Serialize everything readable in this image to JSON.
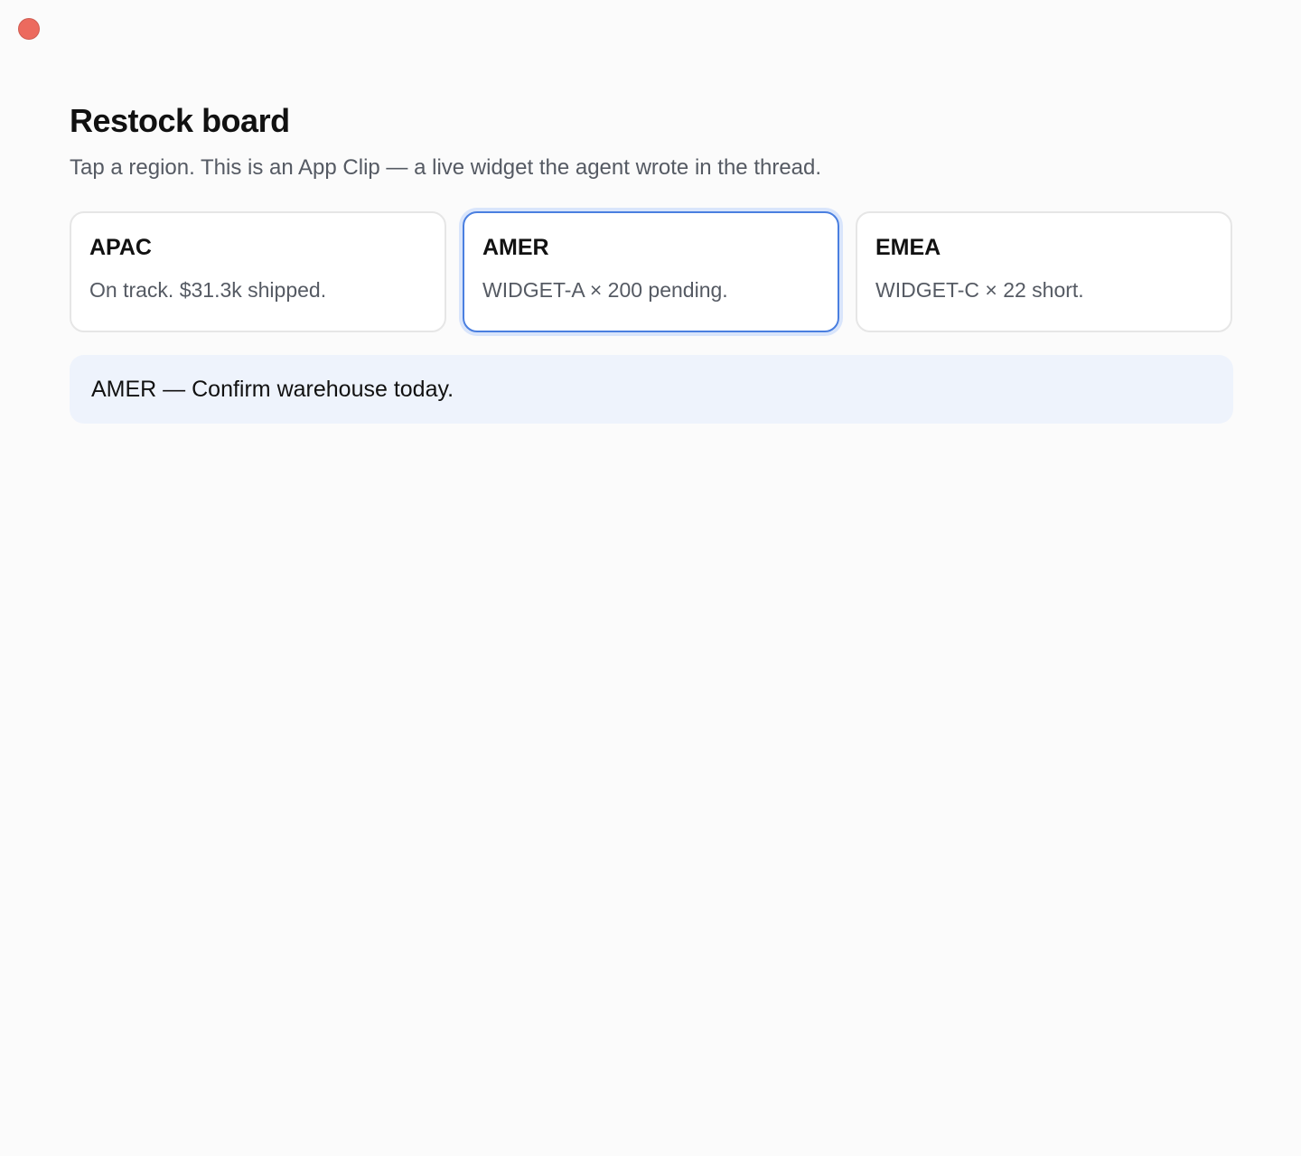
{
  "window": {
    "close_color": "#ec6a5e"
  },
  "header": {
    "title": "Restock board",
    "subtitle": "Tap a region. This is an App Clip — a live widget the agent wrote in the thread."
  },
  "regions": [
    {
      "name": "APAC",
      "status": "On track. $31.3k shipped.",
      "selected": false
    },
    {
      "name": "AMER",
      "status": "WIDGET-A × 200 pending.",
      "selected": true
    },
    {
      "name": "EMEA",
      "status": "WIDGET-C × 22 short.",
      "selected": false
    }
  ],
  "detail": {
    "text": "AMER — Confirm warehouse today."
  },
  "colors": {
    "accent": "#4a7fe0",
    "banner_bg": "#eef3fc"
  }
}
